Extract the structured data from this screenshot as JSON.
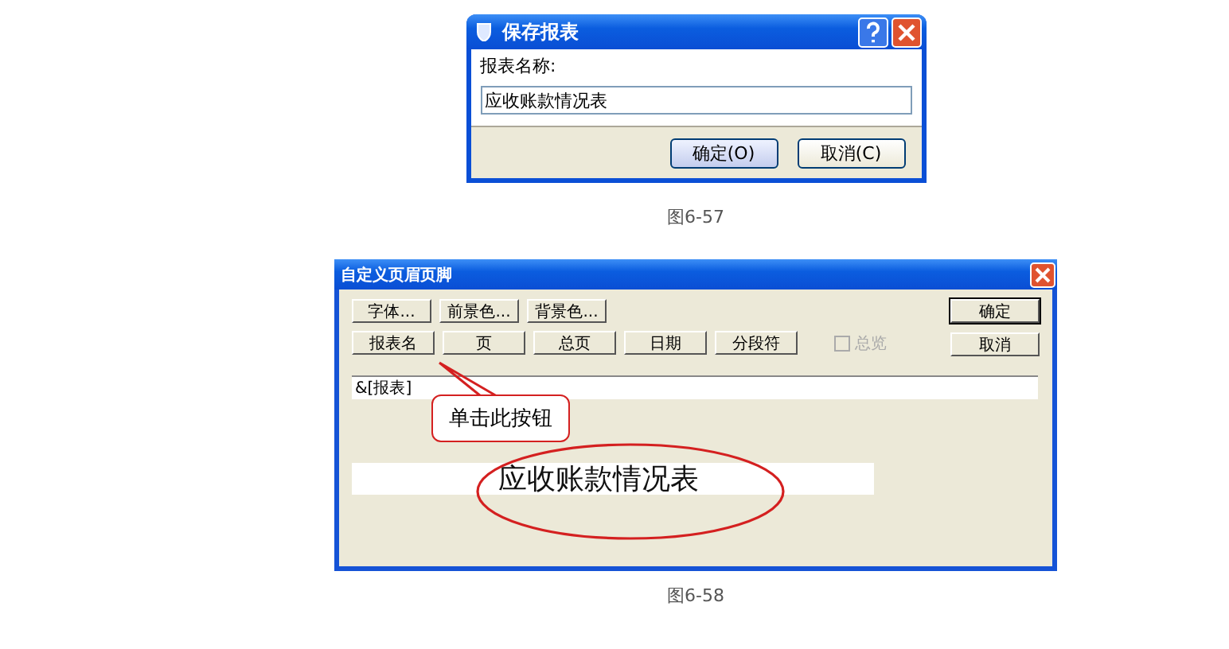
{
  "save_dialog": {
    "title": "保存报表",
    "field_label": "报表名称:",
    "field_value": "应收账款情况表",
    "buttons": [
      {
        "label": "确定(O)",
        "default": true
      },
      {
        "label": "取消(C)",
        "default": false
      }
    ]
  },
  "caption_1": "图6-57",
  "header_footer_dialog": {
    "title": "自定义页眉页脚",
    "button_row_1": [
      "字体...",
      "前景色...",
      "背景色..."
    ],
    "button_row_2": [
      "报表名",
      "页",
      "总页",
      "日期",
      "分段符"
    ],
    "checkbox": {
      "label": "总览",
      "checked": false,
      "disabled": true
    },
    "side_buttons": [
      {
        "label": "确定",
        "default": true
      },
      {
        "label": "取消",
        "default": false
      }
    ],
    "field_value": "&[报表]",
    "preview_text": "应收账款情况表",
    "callout": "单击此按钮"
  },
  "caption_2": "图6-58"
}
